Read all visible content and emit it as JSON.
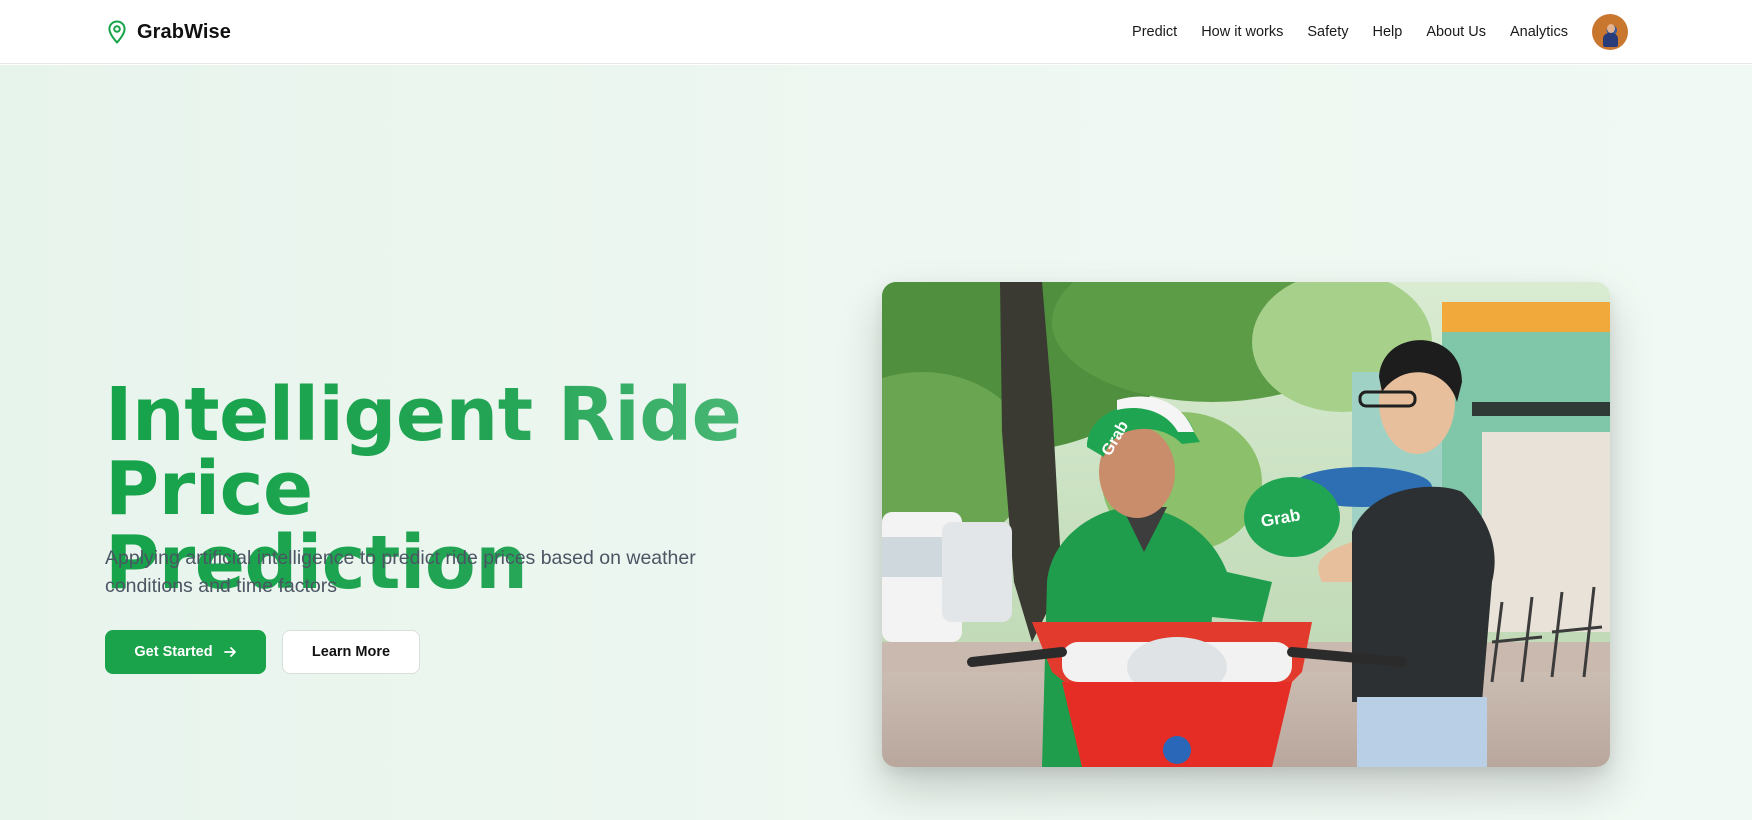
{
  "brand": {
    "name": "GrabWise",
    "icon": "map-pin-icon",
    "accent": "#16a34a"
  },
  "nav": {
    "links": [
      "Predict",
      "How it works",
      "Safety",
      "Help",
      "About Us",
      "Analytics"
    ],
    "avatar_icon": "user-avatar"
  },
  "hero": {
    "title_line1": "Intelligent Ride Price",
    "title_line2": "Prediction",
    "subtitle": "Applying artificial intelligence to predict ride prices based on weather conditions and time factors",
    "primary_cta": "Get Started",
    "primary_cta_icon": "arrow-right-icon",
    "secondary_cta": "Learn More",
    "image_alt": "Grab driver handing a green helmet to a passenger",
    "helmet_text": "Grab",
    "background_colors": [
      "#e7f4ec",
      "#f1f9f4"
    ]
  }
}
